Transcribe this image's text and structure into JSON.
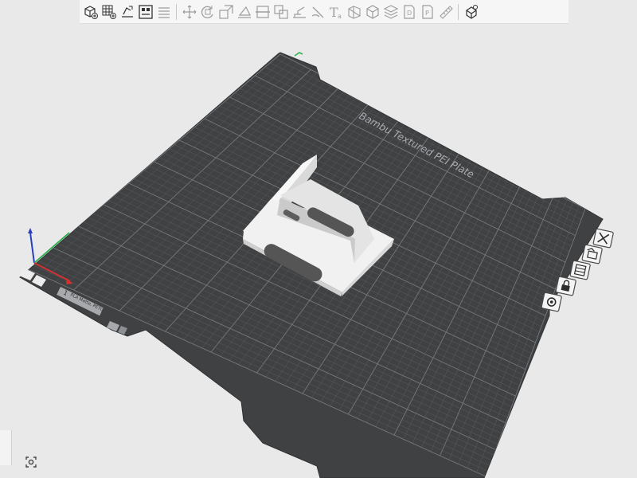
{
  "toolbar": {
    "items": [
      {
        "icon": "add-cube-icon",
        "enabled": true
      },
      {
        "icon": "add-grid-icon",
        "enabled": true
      },
      {
        "icon": "auto-orient-icon",
        "enabled": true
      },
      {
        "icon": "arrange-icon",
        "enabled": true
      },
      {
        "icon": "plate-list-icon",
        "enabled": false
      },
      {
        "icon": "move-icon",
        "enabled": false
      },
      {
        "icon": "rotate-icon",
        "enabled": false
      },
      {
        "icon": "scale-icon",
        "enabled": false
      },
      {
        "icon": "lay-on-face-icon",
        "enabled": false
      },
      {
        "icon": "cut-icon",
        "enabled": false
      },
      {
        "icon": "boolean-icon",
        "enabled": false
      },
      {
        "icon": "support-paint-icon",
        "enabled": false
      },
      {
        "icon": "seam-paint-icon",
        "enabled": false
      },
      {
        "icon": "text-icon",
        "enabled": false
      },
      {
        "icon": "mesh-icon",
        "enabled": false
      },
      {
        "icon": "assemble-icon",
        "enabled": false
      },
      {
        "icon": "layers-icon",
        "enabled": false
      },
      {
        "icon": "page-d-icon",
        "enabled": false
      },
      {
        "icon": "page-p-icon",
        "enabled": false
      },
      {
        "icon": "measure-icon",
        "enabled": false
      },
      {
        "icon": "assembly-view-icon",
        "enabled": true
      }
    ]
  },
  "plate": {
    "label": "Bambu Textured PEI Plate",
    "number": "1",
    "tag": "PLA Matte, PETG",
    "colors": {
      "plate": "#3f4143",
      "grid_minor": "#5a5c5f",
      "grid_major": "#76797c",
      "part": "#eeeeee",
      "label": "#a9acaf"
    }
  },
  "axes": {
    "x_color": "#d43030",
    "y_color": "#22aa44",
    "z_color": "#2a3fbf"
  },
  "side_tools": [
    {
      "icon": "close-icon"
    },
    {
      "icon": "auto-orient-plate-icon"
    },
    {
      "icon": "arrange-plate-icon"
    },
    {
      "icon": "lock-icon"
    },
    {
      "icon": "settings-icon"
    }
  ],
  "view_button": {
    "icon": "view-icon"
  }
}
